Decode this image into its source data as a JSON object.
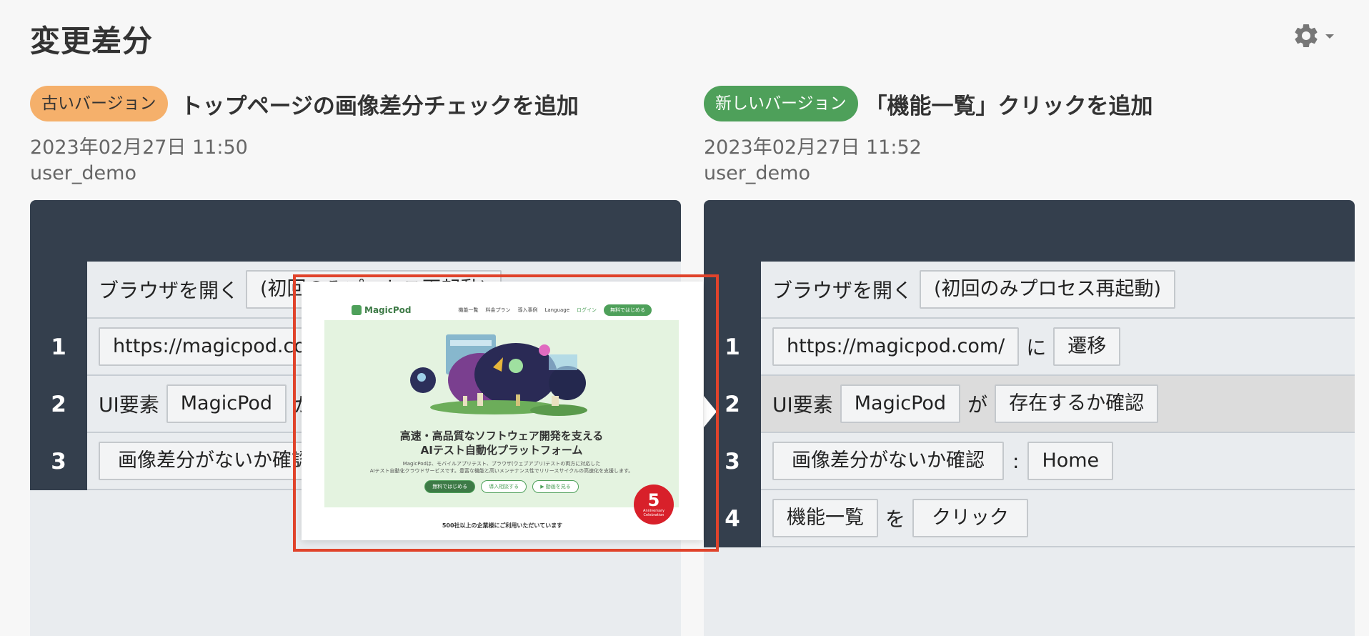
{
  "page": {
    "title": "変更差分"
  },
  "settings": {
    "icon": "gear-icon",
    "dropdown_icon": "caret-down-icon"
  },
  "old_version": {
    "badge": "古いバージョン",
    "title": "トップページの画像差分チェックを追加",
    "date": "2023年02月27日 11:50",
    "user": "user_demo",
    "steps": [
      {
        "number": "",
        "text": "ブラウザを開く",
        "value": "(初回のみプロセス再起動)"
      },
      {
        "number": "1",
        "url": "https://magicpod.com/"
      },
      {
        "number": "2",
        "prefix": "UI要素",
        "element": "MagicPod",
        "particle": "が"
      },
      {
        "number": "3",
        "action": "画像差分がないか確認"
      }
    ]
  },
  "new_version": {
    "badge": "新しいバージョン",
    "title": "「機能一覧」クリックを追加",
    "date": "2023年02月27日 11:52",
    "user": "user_demo",
    "steps": [
      {
        "number": "",
        "text": "ブラウザを開く",
        "value": "(初回のみプロセス再起動)"
      },
      {
        "number": "1",
        "url": "https://magicpod.com/",
        "particle": "に",
        "action": "遷移"
      },
      {
        "number": "2",
        "prefix": "UI要素",
        "element": "MagicPod",
        "particle": "が",
        "action": "存在するか確認"
      },
      {
        "number": "3",
        "action": "画像差分がないか確認",
        "separator": ":",
        "target": "Home"
      },
      {
        "number": "4",
        "element": "機能一覧",
        "particle": "を",
        "action": "クリック"
      }
    ]
  },
  "preview": {
    "logo_text": "MagicPod",
    "nav": [
      "機能一覧",
      "料金プラン",
      "導入事例",
      "Language",
      "ログイン"
    ],
    "nav_cta": "無料ではじめる",
    "headline_1": "高速・高品質なソフトウェア開発を支える",
    "headline_2": "AIテスト自動化プラットフォーム",
    "sub_1": "MagicPodは、モバイルアプリテスト、ブラウザ(ウェブアプリ)テストの両方に対応した",
    "sub_2": "AIテスト自動化クラウドサービスです。豊富な機能と高いメンテナンス性でリリースサイクルの高速化を支援します。",
    "buttons": [
      "無料ではじめる",
      "導入相談する",
      "▶ 動画を見る"
    ],
    "seal_number": "5",
    "seal_text_1": "Anniversary",
    "seal_text_2": "Celebration",
    "footer": "500社以上の企業様にご利用いただいています",
    "highlight_color": "#e0432b"
  },
  "colors": {
    "table_header": "#343f4d",
    "old_badge": "#f5b06b",
    "new_badge": "#4ea05a",
    "brand_green": "#4ea05a"
  }
}
